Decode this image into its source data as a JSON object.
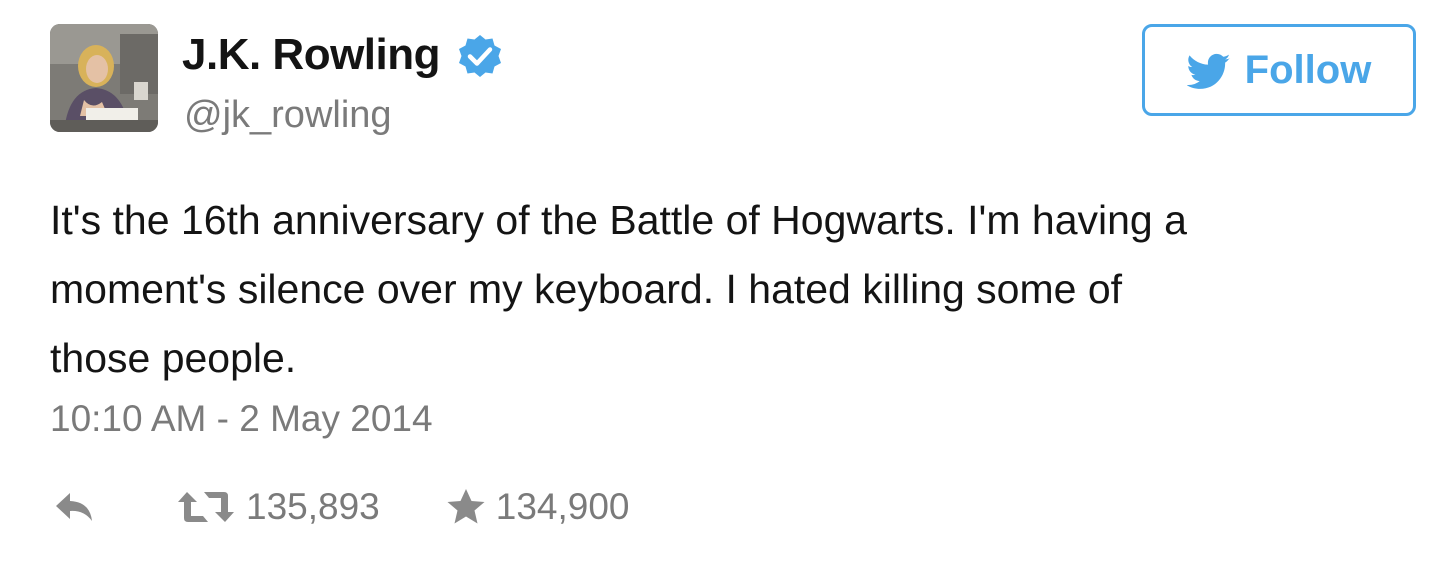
{
  "author": {
    "display_name": "J.K. Rowling",
    "handle": "@jk_rowling",
    "verified": true
  },
  "follow_button": {
    "label": "Follow",
    "icon": "twitter-bird-icon"
  },
  "tweet": {
    "lines": [
      "It's the 16th anniversary of the Battle of Hogwarts. I'm having a",
      "moment's silence over my keyboard. I hated killing some of",
      "those people."
    ],
    "timestamp": "10:10 AM - 2 May 2014"
  },
  "actions": {
    "reply_icon": "reply-icon",
    "retweet_icon": "retweet-icon",
    "retweet_count": "135,893",
    "favorite_icon": "star-icon",
    "favorite_count": "134,900"
  },
  "colors": {
    "accent": "#4aa6e8",
    "verified": "#4aa6e8",
    "muted_text": "#7a7a7a",
    "text": "#141414"
  }
}
